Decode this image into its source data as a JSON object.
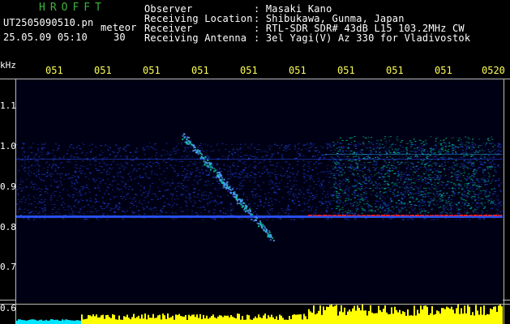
{
  "brand": "HROFFT",
  "file": {
    "name_line": "UT2505090510.pn",
    "meteor_label": "meteor",
    "date_line": "25.05.09 05:10",
    "number": "30"
  },
  "info": {
    "labels": [
      "Observer",
      "Receiving Location",
      "Receiver",
      "Receiving Antenna"
    ],
    "values": [
      ": Masaki Kano",
      ": Shibukawa, Gunma, Japan",
      ": RTL-SDR SDR# 43dB L15 103.2MHz CW",
      ": 3el Yagi(V) Az 330 for Vladivostok"
    ]
  },
  "plot": {
    "unit": "kHz",
    "time_ticks": [
      "051",
      "051",
      "051",
      "051",
      "051",
      "051",
      "051",
      "051",
      "051",
      "0520"
    ],
    "freq_ticks": [
      "1.1",
      "1.0",
      "0.9",
      "0.8",
      "0.7",
      "0.6"
    ]
  },
  "colors": {
    "background": "#000000",
    "noise": "#1a3cc8",
    "echo": "#00d2a0",
    "carrier": "#ff2020",
    "power": "#ffff00",
    "power_edge": "#00e5ff"
  }
}
